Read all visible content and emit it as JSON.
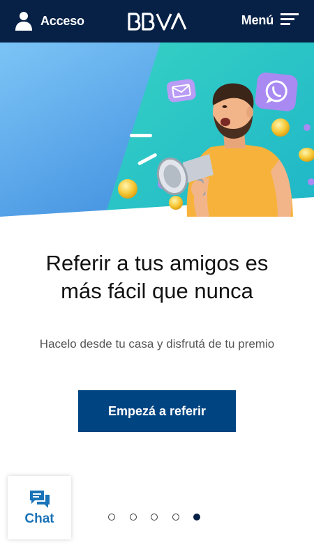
{
  "header": {
    "access_label": "Acceso",
    "brand": "BBVA",
    "menu_label": "Menú"
  },
  "hero": {
    "title": "Referir a tus amigos es más fácil que nunca",
    "subtitle": "Hacelo desde tu casa y disfrutá de tu premio",
    "cta_label": "Empezá a referir"
  },
  "chat": {
    "label": "Chat"
  },
  "carousel": {
    "total_slides": 5,
    "active_slide": 5
  },
  "colors": {
    "header_bg": "#072146",
    "cta_bg": "#004481",
    "chat_accent": "#1973b8",
    "hero_left": "#4aa3e6",
    "hero_right": "#2cc8c6"
  }
}
